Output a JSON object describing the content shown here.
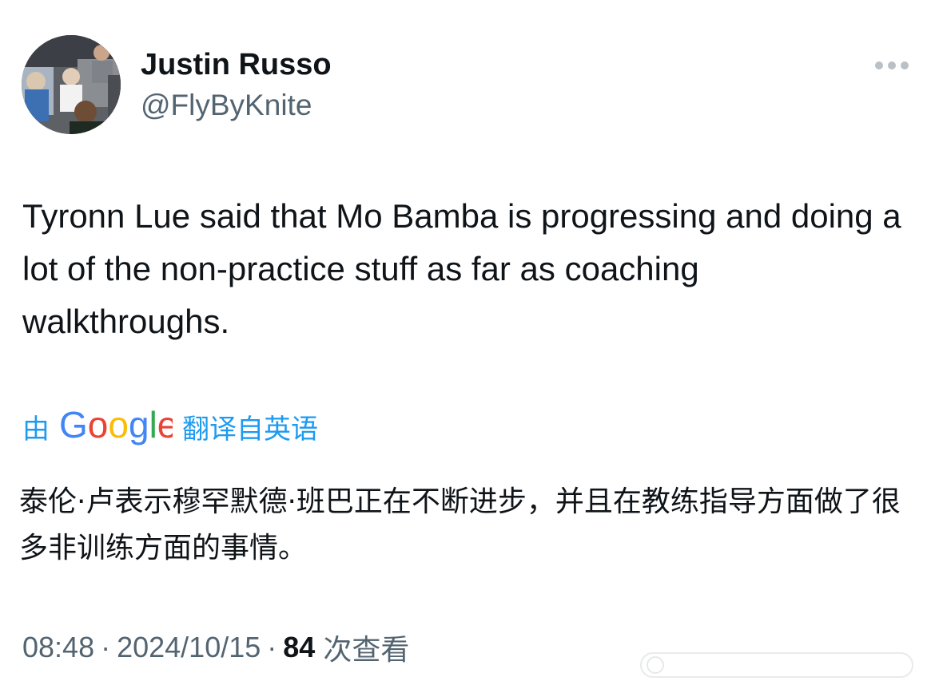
{
  "author": {
    "display_name": "Justin Russo",
    "handle": "@FlyByKnite"
  },
  "tweet": {
    "text": "Tyronn Lue said that Mo Bamba is progressing and doing a lot of the non-practice stuff as far as coaching walkthroughs."
  },
  "translation": {
    "prefix": "由",
    "logo_text": "Google",
    "suffix": "翻译自英语",
    "text": "泰伦·卢表示穆罕默德·班巴正在不断进步，并且在教练指导方面做了很多非训练方面的事情。"
  },
  "meta": {
    "time": "08:48",
    "separator": "·",
    "date": "2024/10/15",
    "views_count": "84",
    "views_label": "次查看"
  },
  "icons": {
    "more": "more-horizontal-icon",
    "google_logo": "google-logo",
    "watermark": "watermark"
  },
  "colors": {
    "link_blue": "#1d9bf0",
    "secondary_text": "#536471",
    "primary_text": "#0f1419",
    "google_blue": "#4285f4",
    "google_red": "#ea4335",
    "google_yellow": "#fbbc05",
    "google_green": "#34a853"
  }
}
